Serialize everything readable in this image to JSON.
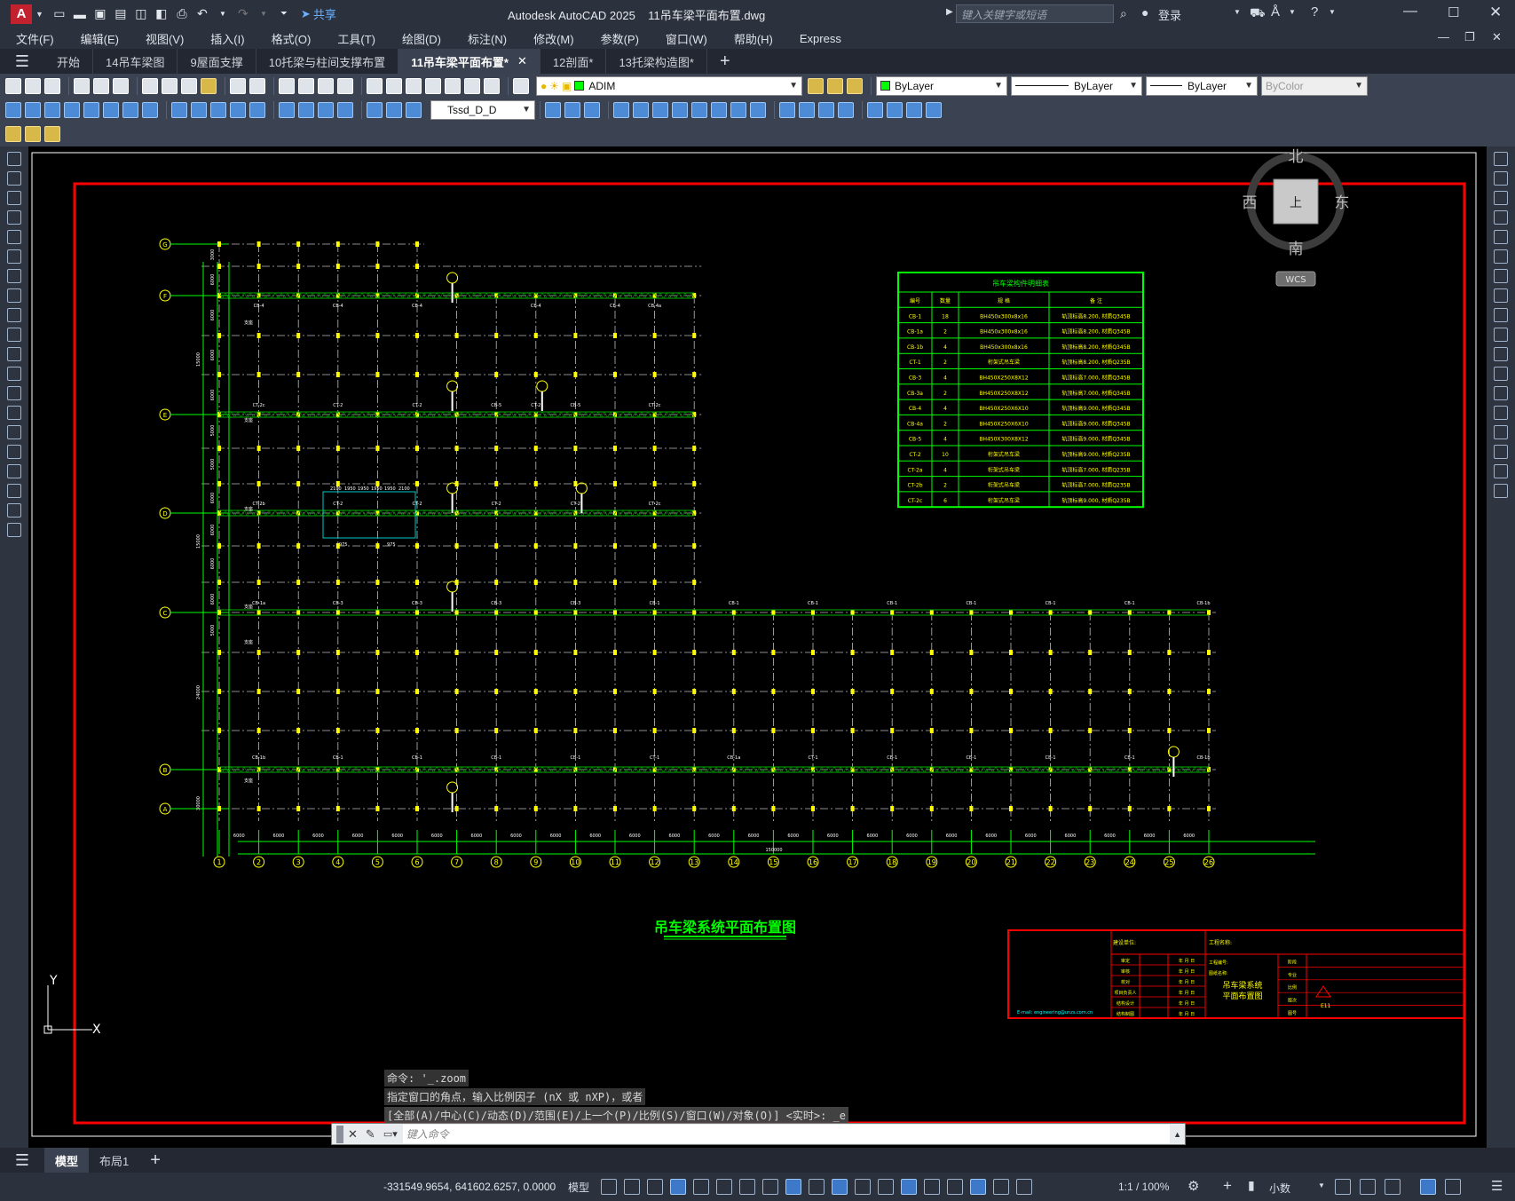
{
  "app": {
    "title": "Autodesk AutoCAD 2025",
    "filename": "11吊车梁平面布置.dwg",
    "search_placeholder": "键入关键字或短语",
    "share_label": "共享",
    "signin_label": "登录"
  },
  "menu": [
    "文件(F)",
    "编辑(E)",
    "视图(V)",
    "插入(I)",
    "格式(O)",
    "工具(T)",
    "绘图(D)",
    "标注(N)",
    "修改(M)",
    "参数(P)",
    "窗口(W)",
    "帮助(H)",
    "Express"
  ],
  "doc_tabs": [
    {
      "label": "开始",
      "active": false
    },
    {
      "label": "14吊车梁图",
      "active": false
    },
    {
      "label": "9屋面支撑",
      "active": false
    },
    {
      "label": "10托梁与柱间支撑布置",
      "active": false
    },
    {
      "label": "11吊车梁平面布置*",
      "active": true
    },
    {
      "label": "12剖面*",
      "active": false
    },
    {
      "label": "13托梁构造图*",
      "active": false
    }
  ],
  "toolbar": {
    "layer_value": "ADIM",
    "color_value": "ByLayer",
    "linetype_value": "ByLayer",
    "lineweight_value": "ByLayer",
    "plotstyle_value": "ByColor",
    "dimstyle_value": "Tssd_D_D"
  },
  "viewcube": {
    "north": "北",
    "south": "南",
    "east": "东",
    "west": "西",
    "top": "上",
    "wcs": "WCS"
  },
  "ucs": {
    "y_label": "Y",
    "x_label": "X"
  },
  "drawing": {
    "title": "吊车梁系统平面布置图",
    "total_dim": "150000",
    "bay_dim": "6000",
    "axis_numbers": [
      "1",
      "2",
      "3",
      "4",
      "5",
      "6",
      "7",
      "8",
      "9",
      "10",
      "11",
      "12",
      "13",
      "14",
      "15",
      "16",
      "17",
      "18",
      "19",
      "20",
      "21",
      "22",
      "23",
      "24",
      "25",
      "26"
    ],
    "axis_letters": [
      "G",
      "F",
      "E",
      "D",
      "C",
      "B",
      "A"
    ],
    "left_dims": [
      "3000",
      "6000",
      "6000",
      "6000",
      "6000",
      "5000",
      "5000",
      "6000",
      "6000",
      "6000",
      "6000",
      "5000"
    ],
    "left_total_dims": [
      "15000",
      "15000",
      "24000",
      "30000"
    ],
    "beam_labels_row1": [
      "CB-4",
      "CB-4",
      "CB-4",
      "CB-4",
      "CB-4",
      "CB-4a"
    ],
    "beam_labels_row2": [
      "CT-2c",
      "CT-2",
      "CT-2",
      "CB-5",
      "CT-2",
      "CB-5",
      "CT-2c"
    ],
    "beam_labels_row3": [
      "CT-2b",
      "CT-2",
      "CT-2",
      "CT-2",
      "CT-2",
      "CT-2c"
    ],
    "beam_labels_row4": [
      "CB-1a",
      "CB-3",
      "CB-3",
      "CB-3",
      "CB-3",
      "CB-1",
      "CB-1",
      "CB-1",
      "CB-1",
      "CB-1",
      "CB-1",
      "CB-1",
      "CB-1b"
    ],
    "beam_labels_row5": [
      "CB-1b",
      "CB-1",
      "CB-1",
      "CB-1",
      "CB-1",
      "CT-1",
      "CB-1a",
      "CT-1",
      "CB-1",
      "CB-1",
      "CB-1",
      "CB-1",
      "CB-1b"
    ],
    "small_labels": [
      "支座",
      "支座",
      "支座",
      "支座",
      "支座",
      "支座",
      "支座",
      "支座"
    ],
    "detail_dims": [
      "2100",
      "1950",
      "1950",
      "1950",
      "1950",
      "2100",
      "975",
      "975"
    ]
  },
  "table": {
    "title": "吊车梁构件明细表",
    "headers": [
      "编号",
      "数量",
      "规 格",
      "备 注"
    ],
    "rows": [
      [
        "CB-1",
        "18",
        "BH450x300x8x16",
        "轨顶标高8.200, 材质Q345B"
      ],
      [
        "CB-1a",
        "2",
        "BH450x300x8x16",
        "轨顶标高8.200, 材质Q345B"
      ],
      [
        "CB-1b",
        "4",
        "BH450x300x8x16",
        "轨顶标高8.200, 材质Q345B"
      ],
      [
        "CT-1",
        "2",
        "桁架式吊车梁",
        "轨顶标高8.200, 材质Q235B"
      ],
      [
        "CB-3",
        "4",
        "BH450X250X8X12",
        "轨顶标高7.000, 材质Q345B"
      ],
      [
        "CB-3a",
        "2",
        "BH450X250X8X12",
        "轨顶标高7.000, 材质Q345B"
      ],
      [
        "CB-4",
        "4",
        "BH450X250X6X10",
        "轨顶标高9.000, 材质Q345B"
      ],
      [
        "CB-4a",
        "2",
        "BH450X250X6X10",
        "轨顶标高9.000, 材质Q345B"
      ],
      [
        "CB-5",
        "4",
        "BH450X300X8X12",
        "轨顶标高9.000, 材质Q345B"
      ],
      [
        "CT-2",
        "10",
        "桁架式吊车梁",
        "轨顶标高9.000, 材质Q235B"
      ],
      [
        "CT-2a",
        "4",
        "桁架式吊车梁",
        "轨顶标高7.000, 材质Q235B"
      ],
      [
        "CT-2b",
        "2",
        "桁架式吊车梁",
        "轨顶标高7.000, 材质Q235B"
      ],
      [
        "CT-2c",
        "6",
        "桁架式吊车梁",
        "轨顶标高9.000, 材质Q235B"
      ]
    ]
  },
  "titleblock": {
    "design_unit": "建设单位:",
    "project_name": "工程名称:",
    "drawing_name": "吊车梁系统",
    "drawing_name2": "平面布置图",
    "project_no": "工程编号:",
    "sheet_name": "图纸名称:",
    "email": "E-mail: engineering@unzs.com.cn",
    "roles": [
      "审定",
      "审核",
      "校对",
      "项目负责人",
      "结构设计",
      "结构制图"
    ],
    "date_label": "年 月 日",
    "right_labels": [
      "阶段",
      "专业",
      "比例",
      "版次",
      "图号"
    ],
    "sheet_no": "E11"
  },
  "command": {
    "history1": "命令: '_.zoom",
    "history2": "指定窗口的角点，输入比例因子 (nX 或 nXP)，或者",
    "history3": "[全部(A)/中心(C)/动态(D)/范围(E)/上一个(P)/比例(S)/窗口(W)/对象(O)] <实时>: _e",
    "placeholder": "键入命令"
  },
  "layout_tabs": [
    {
      "label": "模型",
      "active": true
    },
    {
      "label": "布局1",
      "active": false
    }
  ],
  "status": {
    "coords": "-331549.9654, 641602.6257, 0.0000",
    "model_label": "模型",
    "scale": "1:1 / 100%",
    "units": "小数"
  }
}
